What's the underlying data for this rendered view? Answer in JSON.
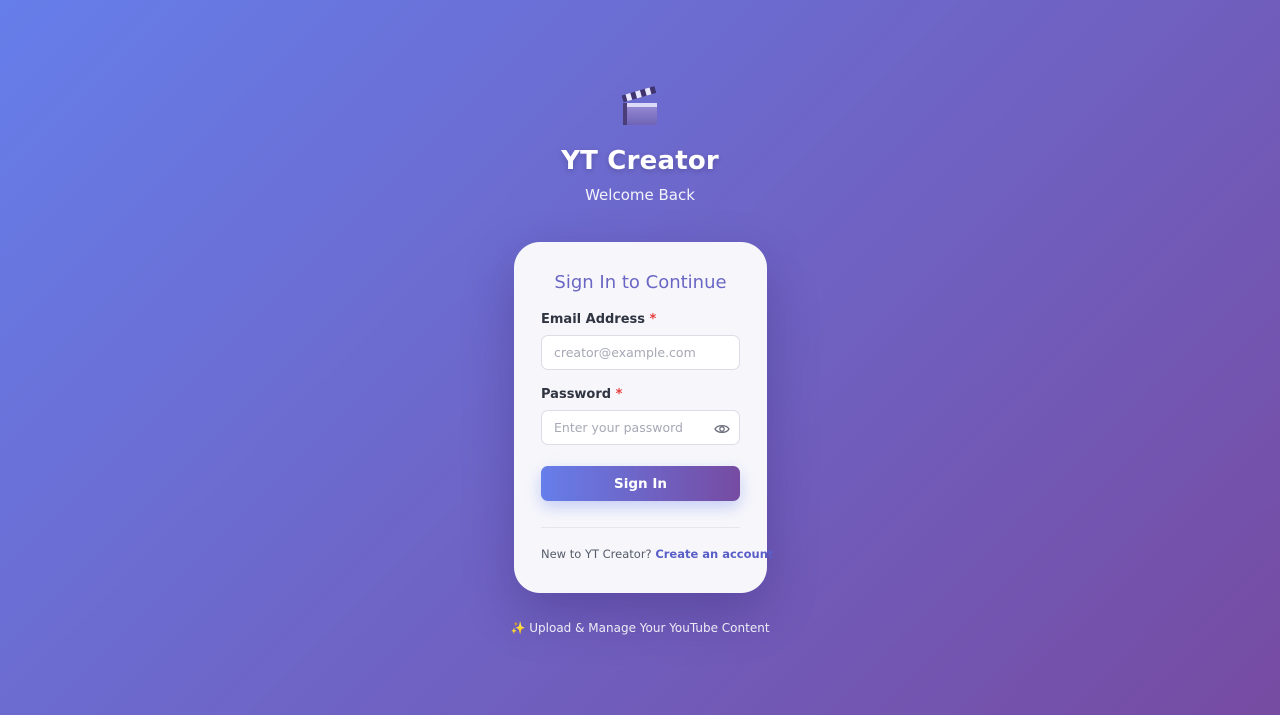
{
  "header": {
    "logo_icon": "clapperboard-icon",
    "title": "YT Creator",
    "subtitle": "Welcome Back"
  },
  "card": {
    "title": "Sign In to Continue",
    "email": {
      "label": "Email Address",
      "required_mark": "*",
      "placeholder": "creator@example.com",
      "value": ""
    },
    "password": {
      "label": "Password",
      "required_mark": "*",
      "placeholder": "Enter your password",
      "value": "",
      "toggle_icon": "eye-icon"
    },
    "submit_label": "Sign In",
    "footer_prompt": "New to YT Creator?",
    "footer_link": "Create an account"
  },
  "tagline": {
    "icon": "sparkles-icon",
    "text": "Upload & Manage Your YouTube Content"
  },
  "colors": {
    "gradient_start": "#667eea",
    "gradient_end": "#764ba2",
    "card_bg": "#f7f7fb",
    "required": "#e53e3e",
    "link": "#5a5fc8"
  }
}
